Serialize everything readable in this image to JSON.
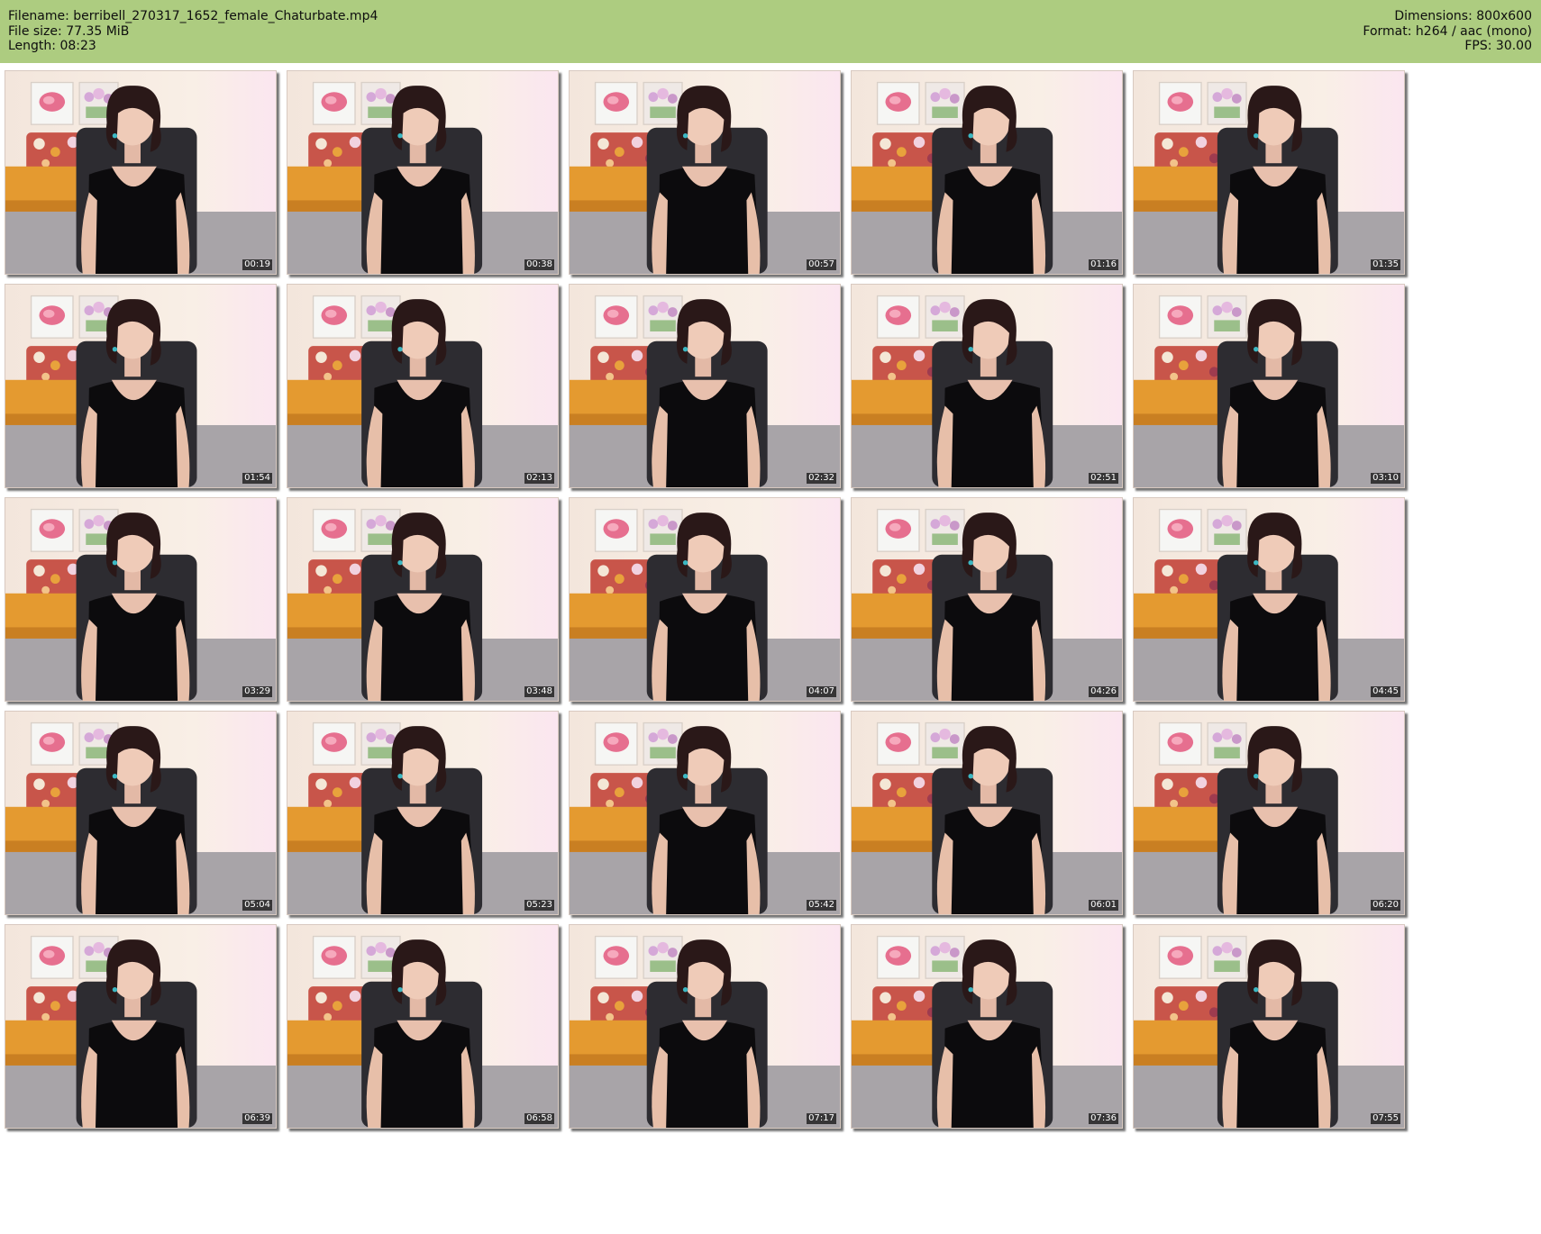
{
  "header": {
    "filename": "Filename: berribell_270317_1652_female_Chaturbate.mp4",
    "filesize": "File size: 77.35 MiB",
    "length": "Length: 08:23",
    "dimensions": "Dimensions: 800x600",
    "format": "Format: h264 / aac (mono)",
    "fps": "FPS: 30.00"
  },
  "colors": {
    "header_bg": "#adcc80"
  },
  "thumbnails": [
    {
      "time": "00:19"
    },
    {
      "time": "00:38"
    },
    {
      "time": "00:57"
    },
    {
      "time": "01:16"
    },
    {
      "time": "01:35"
    },
    {
      "time": "01:54"
    },
    {
      "time": "02:13"
    },
    {
      "time": "02:32"
    },
    {
      "time": "02:51"
    },
    {
      "time": "03:10"
    },
    {
      "time": "03:29"
    },
    {
      "time": "03:48"
    },
    {
      "time": "04:07"
    },
    {
      "time": "04:26"
    },
    {
      "time": "04:45"
    },
    {
      "time": "05:04"
    },
    {
      "time": "05:23"
    },
    {
      "time": "05:42"
    },
    {
      "time": "06:01"
    },
    {
      "time": "06:20"
    },
    {
      "time": "06:39"
    },
    {
      "time": "06:58"
    },
    {
      "time": "07:17"
    },
    {
      "time": "07:36"
    },
    {
      "time": "07:55"
    }
  ]
}
